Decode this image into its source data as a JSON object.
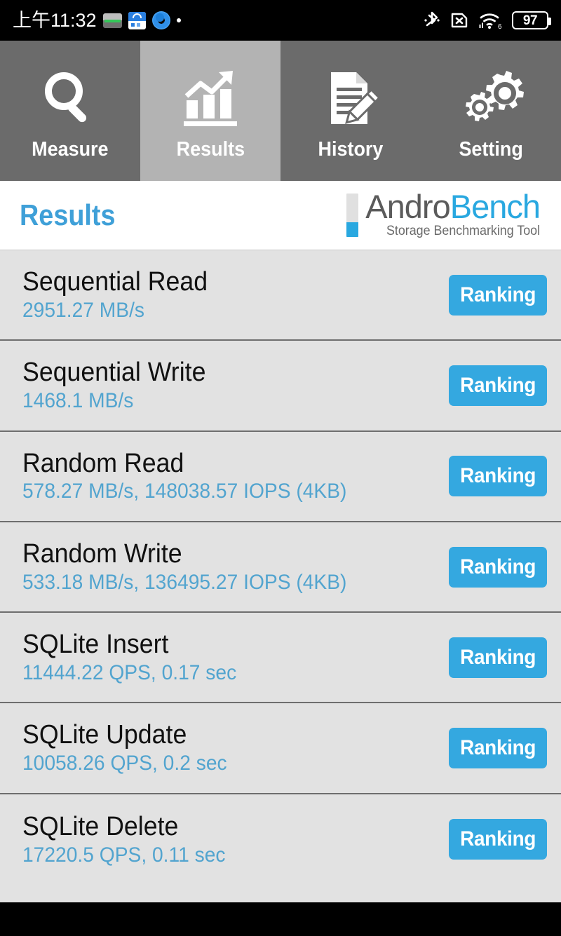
{
  "statusbar": {
    "clock": "上午11:32",
    "left_icons": [
      "storage-icon",
      "calendar-icon",
      "browser-icon",
      "dot-icon"
    ],
    "right_icons": [
      "bluetooth-icon",
      "no-sim-icon",
      "wifi6-icon",
      "battery-icon"
    ],
    "battery_level": "97"
  },
  "tabs": [
    {
      "label": "Measure",
      "icon": "magnifier-icon",
      "active": false
    },
    {
      "label": "Results",
      "icon": "bar-chart-icon",
      "active": true
    },
    {
      "label": "History",
      "icon": "document-pencil-icon",
      "active": false
    },
    {
      "label": "Setting",
      "icon": "gears-icon",
      "active": false
    }
  ],
  "header": {
    "title": "Results",
    "logo": {
      "part1": "Andro",
      "part2": "Bench",
      "tagline": "Storage Benchmarking Tool"
    }
  },
  "results": {
    "ranking_label": "Ranking",
    "rows": [
      {
        "title": "Sequential Read",
        "value": "2951.27 MB/s"
      },
      {
        "title": "Sequential Write",
        "value": "1468.1 MB/s"
      },
      {
        "title": "Random Read",
        "value": "578.27 MB/s, 148038.57 IOPS (4KB)"
      },
      {
        "title": "Random Write",
        "value": "533.18 MB/s, 136495.27 IOPS (4KB)"
      },
      {
        "title": "SQLite Insert",
        "value": "11444.22 QPS, 0.17 sec"
      },
      {
        "title": "SQLite Update",
        "value": "10058.26 QPS, 0.2 sec"
      },
      {
        "title": "SQLite Delete",
        "value": "17220.5 QPS, 0.11 sec"
      }
    ]
  },
  "colors": {
    "accent_blue": "#34a8e0",
    "value_blue": "#52a4cf",
    "title_blue": "#3fa0d8",
    "tab_inactive": "#6b6b6b",
    "tab_active": "#b3b3b3",
    "list_bg": "#e2e2e2"
  }
}
